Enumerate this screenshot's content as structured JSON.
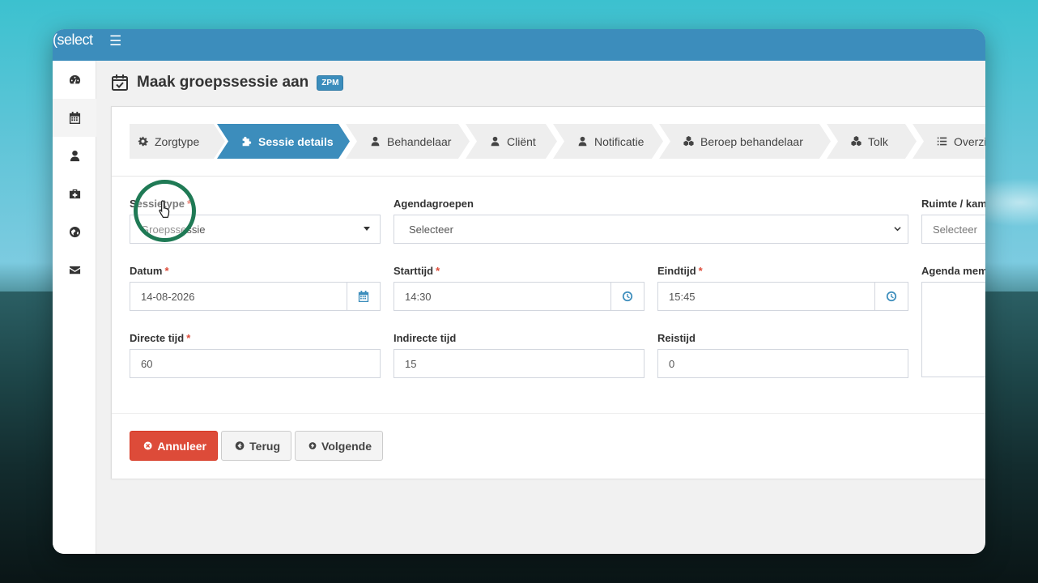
{
  "app": {
    "brand": "(select",
    "menu_icon": "bars-icon"
  },
  "sidebar": {
    "items": [
      {
        "name": "dashboard",
        "icon": "dashboard-icon"
      },
      {
        "name": "calendar",
        "icon": "calendar-icon",
        "active": true
      },
      {
        "name": "user",
        "icon": "user-icon"
      },
      {
        "name": "medkit",
        "icon": "medkit-icon"
      },
      {
        "name": "globe",
        "icon": "globe-icon"
      },
      {
        "name": "mail",
        "icon": "envelope-icon"
      }
    ]
  },
  "page": {
    "title": "Maak groepssessie aan",
    "badge": "ZPM",
    "title_icon": "calendar-check-icon"
  },
  "wizard": {
    "steps": [
      {
        "label": "Zorgtype",
        "icon": "gear-icon"
      },
      {
        "label": "Sessie details",
        "icon": "puzzle-icon",
        "active": true
      },
      {
        "label": "Behandelaar",
        "icon": "user-icon"
      },
      {
        "label": "Cliënt",
        "icon": "user-icon"
      },
      {
        "label": "Notificatie",
        "icon": "user-icon"
      },
      {
        "label": "Beroep behandelaar",
        "icon": "cubes-icon"
      },
      {
        "label": "Tolk",
        "icon": "cubes-icon"
      },
      {
        "label": "Overzi",
        "icon": "list-icon"
      }
    ]
  },
  "form": {
    "sessietype": {
      "label": "Sessietype",
      "value": "Groepssessie",
      "required": "*"
    },
    "agendagroepen": {
      "label": "Agendagroepen",
      "value": "Selecteer"
    },
    "ruimte": {
      "label": "Ruimte / kam",
      "value": "Selecteer"
    },
    "datum": {
      "label": "Datum",
      "value": "14-08-2026",
      "required": "*"
    },
    "starttijd": {
      "label": "Starttijd",
      "value": "14:30",
      "required": "*"
    },
    "eindtijd": {
      "label": "Eindtijd",
      "value": "15:45",
      "required": "*"
    },
    "agenda_memo": {
      "label": "Agenda meme"
    },
    "directe_tijd": {
      "label": "Directe tijd",
      "value": "60",
      "required": "*"
    },
    "indirecte_tijd": {
      "label": "Indirecte tijd",
      "value": "15"
    },
    "reistijd": {
      "label": "Reistijd",
      "value": "0"
    }
  },
  "buttons": {
    "cancel": "Annuleer",
    "back": "Terug",
    "next": "Volgende"
  },
  "colors": {
    "primary": "#3c8dbc",
    "danger": "#dd4b39",
    "cursor_ring": "#1f7a55"
  }
}
